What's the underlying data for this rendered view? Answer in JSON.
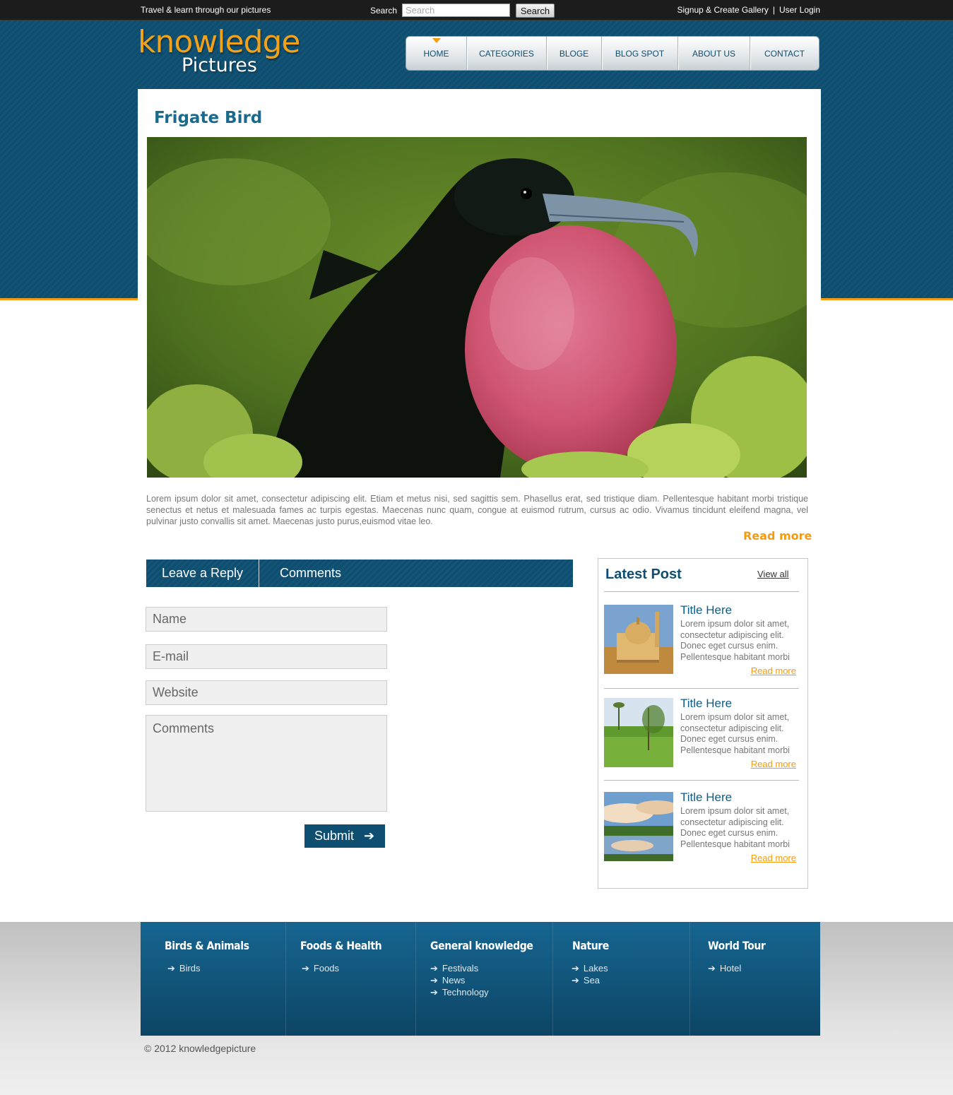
{
  "topbar": {
    "tagline": "Travel & learn through our pictures",
    "search_label": "Search",
    "search_placeholder": "Search",
    "search_button": "Search",
    "signup": "Signup & Create Gallery",
    "separator": "|",
    "login": "User Login"
  },
  "logo": {
    "line1": "knowledge",
    "line2": "Pictures"
  },
  "nav": {
    "items": [
      {
        "label": "HOME",
        "active": true
      },
      {
        "label": "CATEGORIES"
      },
      {
        "label": "BLOGE"
      },
      {
        "label": "BLOG SPOT"
      },
      {
        "label": "ABOUT US"
      },
      {
        "label": "CONTACT"
      }
    ]
  },
  "article": {
    "title": "Frigate Bird",
    "body": "Lorem ipsum dolor sit amet, consectetur adipiscing elit. Etiam et metus nisi, sed sagittis sem. Phasellus erat, sed tristique diam. Pellentesque habitant morbi tristique senectus et netus et malesuada fames ac turpis egestas. Maecenas nunc quam, congue at euismod rutrum, cursus ac odio. Vivamus tincidunt eleifend magna, vel pulvinar justo convallis sit amet. Maecenas justo purus,euismod vitae leo.",
    "read_more": "Read more"
  },
  "tabs": {
    "leave_reply": "Leave a Reply",
    "comments": "Comments"
  },
  "form": {
    "name_placeholder": "Name",
    "email_placeholder": "E-mail",
    "website_placeholder": "Website",
    "comments_placeholder": "Comments",
    "submit": "Submit",
    "submit_arrow": "➔"
  },
  "sidebar": {
    "title": "Latest Post",
    "view_all": "View all",
    "posts": [
      {
        "title": "Title Here",
        "text": "Lorem ipsum dolor sit amet, consectetur adipiscing elit. Donec eget cursus enim. Pellentesque habitant morbi",
        "read_more": "Read more"
      },
      {
        "title": "Title Here",
        "text": "Lorem ipsum dolor sit amet, consectetur adipiscing elit. Donec eget cursus enim. Pellentesque habitant morbi",
        "read_more": "Read more"
      },
      {
        "title": "Title Here",
        "text": "Lorem ipsum dolor sit amet, consectetur adipiscing elit. Donec eget cursus enim. Pellentesque habitant morbi",
        "read_more": "Read more"
      }
    ]
  },
  "footer": {
    "columns": [
      {
        "heading": "Birds & Animals",
        "links": [
          "Birds"
        ]
      },
      {
        "heading": "Foods & Health",
        "links": [
          "Foods"
        ]
      },
      {
        "heading": "General knowledge",
        "links": [
          "Festivals",
          "News",
          "Technology"
        ]
      },
      {
        "heading": "Nature",
        "links": [
          "Lakes",
          "Sea"
        ]
      },
      {
        "heading": "World Tour",
        "links": [
          "Hotel"
        ]
      }
    ],
    "arrow": "➔",
    "copyright": "© 2012 knowledgepicture"
  },
  "colors": {
    "brand_blue": "#0e4e70",
    "accent_orange": "#f39c12",
    "title_blue": "#1a6a8e"
  }
}
